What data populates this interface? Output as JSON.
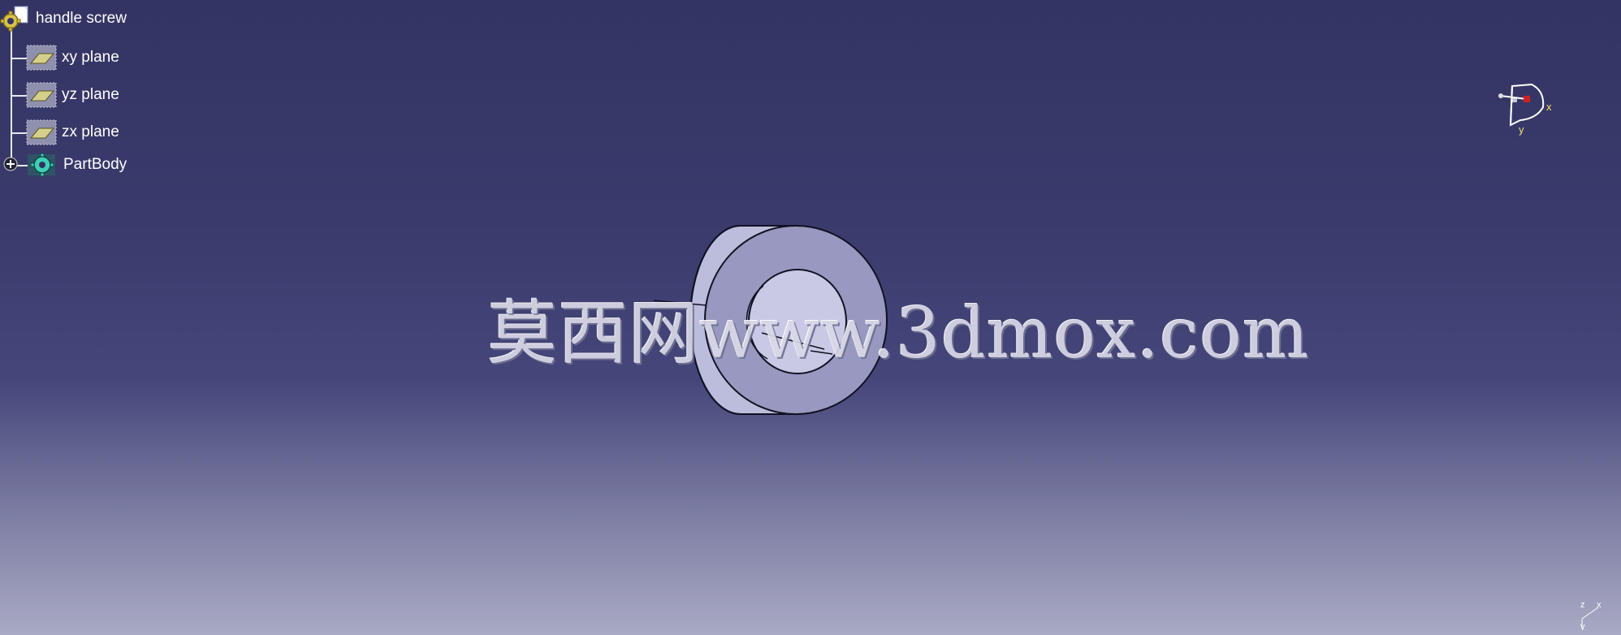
{
  "app": {
    "background_colors": [
      "#333463",
      "#45467a",
      "#a9aac4"
    ]
  },
  "tree": {
    "root": {
      "label": "handle screw",
      "icon": "part-gear-icon"
    },
    "planes": [
      {
        "label": "xy plane",
        "icon": "plane-icon"
      },
      {
        "label": "yz plane",
        "icon": "plane-icon"
      },
      {
        "label": "zx plane",
        "icon": "plane-icon"
      }
    ],
    "body": {
      "label": "PartBody",
      "icon": "partbody-gear-icon",
      "expander": "plus-expand-icon"
    }
  },
  "compass": {
    "x_label": "x",
    "y_label": "y"
  },
  "mini_axis": {
    "z_label": "z",
    "x_label": "x",
    "y_label": "y"
  },
  "watermark": {
    "text": "莫西网www.3dmox.com"
  },
  "model": {
    "shape": "hollow-cylinder",
    "face_color": "#c3c3e0",
    "edge_color": "#111122"
  }
}
